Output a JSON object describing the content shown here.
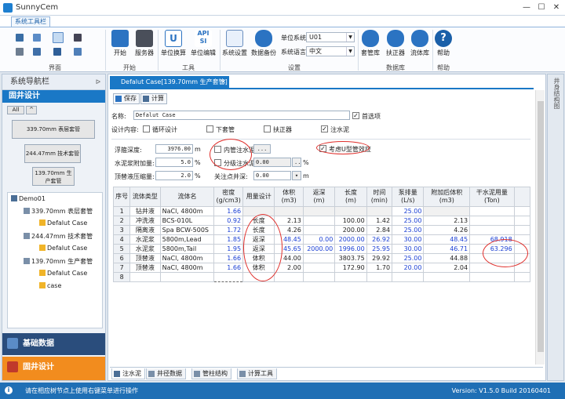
{
  "window": {
    "title": "SunnyCem",
    "minimize": "—",
    "maximize": "☐",
    "close": "✕"
  },
  "ribbon": {
    "tab": "系统工具栏",
    "groups": {
      "interface": "界面",
      "start": "开始",
      "tools": "工具",
      "settings": "设置",
      "database": "数据库",
      "help": "帮助"
    },
    "buttons": {
      "start": "开始",
      "server": "服务器",
      "unit_convert": "单位换算",
      "unit_edit": "单位编辑",
      "sys_settings": "系统设置",
      "data_backup": "数据备份",
      "casing_lib": "套管库",
      "centralizer_lib": "扶正器",
      "fluid_lib": "流体库",
      "help": "帮助"
    },
    "unit_system_label": "单位系统",
    "unit_system_value": "U01",
    "language_label": "系统语言",
    "language_value": "中文"
  },
  "sidebar": {
    "title": "系统导航栏",
    "pin": "ᐅ",
    "section": "固井设计",
    "filter_all": "All",
    "filter_up": "^",
    "casing_buttons": [
      "339.70mm 表层套管",
      "244.47mm 技术套管",
      "139.70mm 生产套管"
    ],
    "tree": [
      "Demo01",
      "339.70mm 表层套管",
      "Defalut Case",
      "244.47mm 技术套管",
      "Defalut Case",
      "139.70mm 生产套管",
      "Defalut Case",
      "case"
    ],
    "bottom_basic": "基础数据",
    "bottom_design": "固井设计"
  },
  "document": {
    "tab_title": "Defalut Case[139.70mm 生产套管]",
    "tab_close": "✕",
    "save": "保存",
    "calculate": "计算",
    "name_label": "名称:",
    "name_value": "Defalut Case",
    "first_choice": "首选项",
    "design_content_label": "设计内容:",
    "design_items": [
      {
        "label": "循环设计",
        "checked": false
      },
      {
        "label": "下套管",
        "checked": false
      },
      {
        "label": "扶正器",
        "checked": false
      },
      {
        "label": "注水泥",
        "checked": true
      }
    ],
    "float_depth_label": "浮箍深度:",
    "float_depth_value": "3976.00",
    "float_depth_unit": "m",
    "cement_excess_label": "水泥浆附加量:",
    "cement_excess_value": "5.0",
    "cement_excess_unit": "%",
    "top_pressure_label": "顶替液压缩量:",
    "top_pressure_value": "2.0",
    "top_pressure_unit": "%",
    "inner_cement_label": "内管注水泥",
    "inner_cement_checked": false,
    "inner_cement_btn": "...",
    "stage_cement_label": "分级注水泥",
    "stage_cement_checked": false,
    "stage_cement_value": "0.00",
    "stage_cement_unit": "%",
    "stage_ellipsis": "...",
    "key_depth_label": "关注点井深:",
    "key_depth_value": "0.00",
    "key_depth_unit": "m",
    "u_tube_label": "考虑U型管效应",
    "u_tube_checked": true
  },
  "table": {
    "headers": [
      "序号",
      "流体类型",
      "流体名",
      "密度\n(g/cm3)",
      "用量设计",
      "体积\n(m3)",
      "返深\n(m)",
      "长度\n(m)",
      "时间\n(min)",
      "泵排量\n(L/s)",
      "附加后体积\n(m3)",
      "干水泥用量\n(Ton)"
    ],
    "rows": [
      {
        "idx": "1",
        "type": "钻井液",
        "name": "NaCl, 4800m",
        "density": "1.66",
        "usage": "",
        "volume": "",
        "return_depth": "",
        "length": "",
        "time": "",
        "rate": "25.00",
        "added_vol": "",
        "dry_cement": ""
      },
      {
        "idx": "2",
        "type": "冲洗液",
        "name": "BCS-010L",
        "density": "0.92",
        "usage": "长度",
        "volume": "2.13",
        "return_depth": "",
        "length": "100.00",
        "time": "1.42",
        "rate": "25.00",
        "added_vol": "2.13",
        "dry_cement": ""
      },
      {
        "idx": "3",
        "type": "隔离液",
        "name": "Spa BCW-500S",
        "density": "1.72",
        "usage": "长度",
        "volume": "4.26",
        "return_depth": "",
        "length": "200.00",
        "time": "2.84",
        "rate": "25.00",
        "added_vol": "4.26",
        "dry_cement": ""
      },
      {
        "idx": "4",
        "type": "水泥浆",
        "name": "5800m,Lead",
        "density": "1.85",
        "usage": "返深",
        "volume": "48.45",
        "return_depth": "0.00",
        "length": "2000.00",
        "time": "26.92",
        "rate": "30.00",
        "added_vol": "48.45",
        "dry_cement": "68.918"
      },
      {
        "idx": "5",
        "type": "水泥浆",
        "name": "5800m,Tail",
        "density": "1.95",
        "usage": "返深",
        "volume": "45.65",
        "return_depth": "2000.00",
        "length": "1996.00",
        "time": "25.95",
        "rate": "30.00",
        "added_vol": "46.71",
        "dry_cement": "63.296"
      },
      {
        "idx": "6",
        "type": "顶替液",
        "name": "NaCl, 4800m",
        "density": "1.66",
        "usage": "体积",
        "volume": "44.00",
        "return_depth": "",
        "length": "3803.75",
        "time": "29.92",
        "rate": "25.00",
        "added_vol": "44.88",
        "dry_cement": ""
      },
      {
        "idx": "7",
        "type": "顶替液",
        "name": "NaCl, 4800m",
        "density": "1.66",
        "usage": "体积",
        "volume": "2.00",
        "return_depth": "",
        "length": "172.90",
        "time": "1.70",
        "rate": "20.00",
        "added_vol": "2.04",
        "dry_cement": ""
      },
      {
        "idx": "8",
        "type": "",
        "name": "",
        "density": "",
        "usage": "",
        "volume": "",
        "return_depth": "",
        "length": "",
        "time": "",
        "rate": "",
        "added_vol": "",
        "dry_cement": ""
      }
    ]
  },
  "bottom_tabs": [
    "注水泥",
    "井径数据",
    "管柱结构",
    "计算工具"
  ],
  "right_strip": "井身结构图",
  "status": {
    "hint": "请在相应树节点上使用右键菜单进行操作",
    "version": "Version:  V1.5.0 Build 20160401"
  }
}
